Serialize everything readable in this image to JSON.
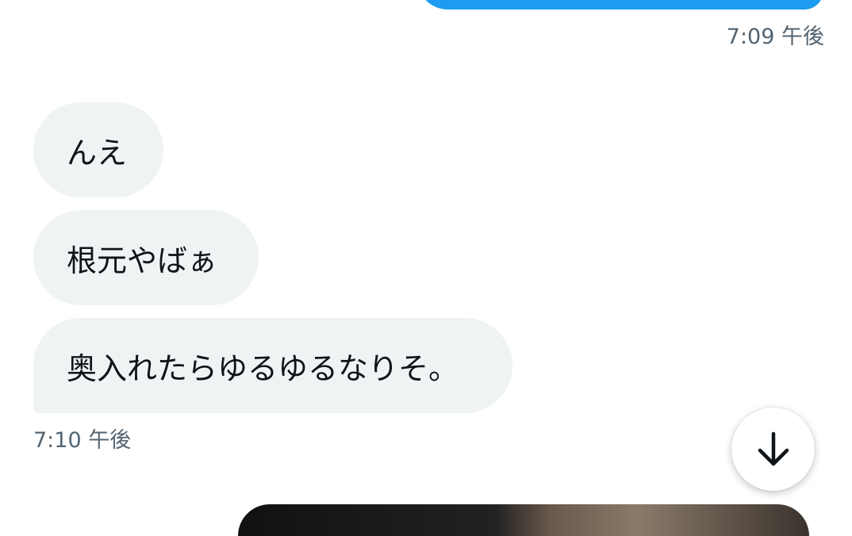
{
  "conversation": {
    "sent_timestamp": "7:09 午後",
    "received": {
      "messages": [
        "んえ",
        "根元やばぁ",
        "奥入れたらゆるゆるなりそ。"
      ],
      "timestamp": "7:10 午後"
    }
  },
  "controls": {
    "scroll_down_icon": "arrow-down-icon"
  },
  "colors": {
    "sent_bubble": "#1d9bf0",
    "received_bubble": "#eff3f4",
    "timestamp_text": "#536471"
  }
}
